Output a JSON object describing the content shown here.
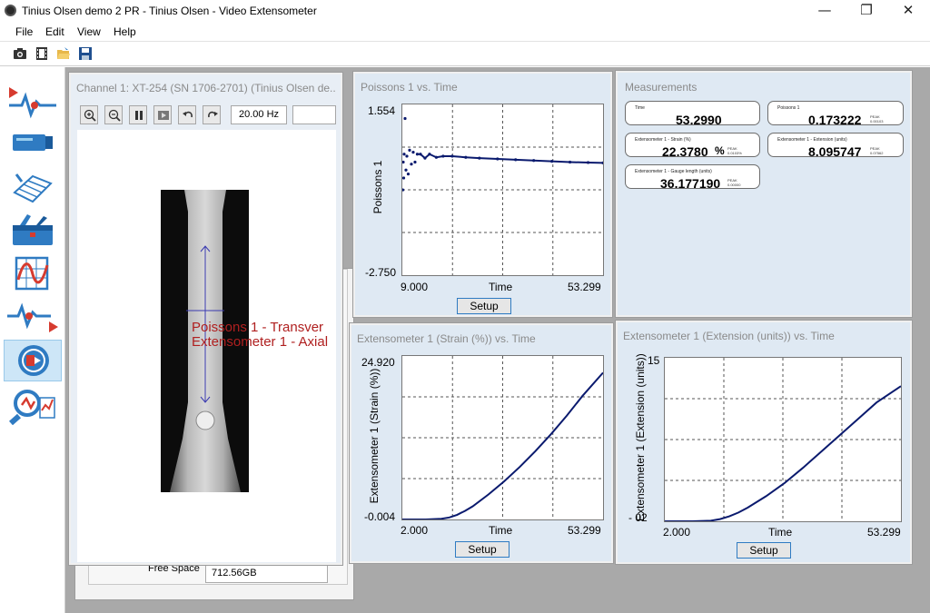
{
  "window": {
    "title": "Tinius Olsen demo 2 PR - Tinius Olsen - Video Extensometer",
    "minimize_glyph": "—",
    "maximize_glyph": "❐",
    "close_glyph": "✕"
  },
  "menu": [
    "File",
    "Edit",
    "View",
    "Help"
  ],
  "toolbar": {
    "icons": [
      "camera-icon",
      "film-icon",
      "open-folder-icon",
      "save-icon"
    ]
  },
  "left_rail": {
    "items": [
      {
        "icon": "signal-play-icon",
        "active": false
      },
      {
        "icon": "extensometer-device-icon",
        "active": false
      },
      {
        "icon": "calibration-grid-icon",
        "active": false
      },
      {
        "icon": "toolbox-icon",
        "active": false
      },
      {
        "icon": "wave-chart-icon",
        "active": false
      },
      {
        "icon": "signal-record-icon",
        "active": false
      },
      {
        "icon": "video-record-icon",
        "active": true
      },
      {
        "icon": "analysis-magnifier-icon",
        "active": false
      }
    ]
  },
  "video_panel": {
    "title": "Channel 1: XT-254 (SN 1706-2701) (Tinius Olsen de...",
    "frequency": "20.00 Hz",
    "buttons": [
      "zoom-in-icon",
      "zoom-out-icon",
      "pause-icon",
      "play-icon",
      "undo-icon",
      "redo-icon"
    ],
    "overlay_line1": "Poissons 1 - Transver",
    "overlay_line2": "Extensometer 1 - Axial"
  },
  "hidden_panel": {
    "free_space_label": "Free Space",
    "free_space_value": "712.56GB"
  },
  "colors": {
    "plot_line": "#0a1a6e",
    "overlay_text": "#b02020",
    "panel_title": "#8a8a8a",
    "active_rail": "#cde6f7",
    "setup_border": "#2f7bc2"
  },
  "charts": [
    {
      "title": "Poissons 1 vs. Time",
      "ylabel": "Poissons 1",
      "xlabel": "Time",
      "ymax_label": "1.554",
      "ymin_label": "-2.750",
      "xmin_label": "9.000",
      "xmax_label": "53.299",
      "setup": "Setup"
    },
    {
      "title": "Extensometer 1 (Strain (%)) vs. Time",
      "ylabel": "Extensometer 1 (Strain (%))",
      "xlabel": "Time",
      "ymax_label": "24.920",
      "ymin_label": "-0.004",
      "xmin_label": "2.000",
      "xmax_label": "53.299",
      "setup": "Setup"
    },
    {
      "title": "Extensometer 1 (Extension (units)) vs. Time",
      "ylabel": "Extensometer 1 (Extension (units))",
      "xlabel": "Time",
      "ymax_label": "15",
      "ymin_label": "- 02",
      "xmin_label": "2.000",
      "xmax_label": "53.299",
      "setup": "Setup"
    }
  ],
  "chart_data": [
    {
      "type": "scatter",
      "title": "Poissons 1 vs. Time",
      "xlabel": "Time",
      "ylabel": "Poissons 1",
      "xlim": [
        9.0,
        53.299
      ],
      "ylim": [
        -2.75,
        1.554
      ],
      "grid": true,
      "series": [
        {
          "x": [
            9.1,
            9.2,
            9.3,
            9.4,
            9.6,
            9.8,
            10.0,
            10.3,
            10.6,
            11.0,
            11.4,
            11.8,
            12.3,
            13.0,
            14.0,
            15.0,
            16.5,
            18.0,
            20.0,
            23.0,
            26.0,
            30.0,
            34.0,
            38.0,
            42.0,
            46.0,
            50.0,
            53.299
          ],
          "y": [
            -0.6,
            0.1,
            -0.3,
            0.3,
            1.2,
            -0.1,
            0.25,
            -0.2,
            0.4,
            0.05,
            0.35,
            0.1,
            0.3,
            0.3,
            0.2,
            0.3,
            0.22,
            0.25,
            0.25,
            0.22,
            0.2,
            0.18,
            0.16,
            0.14,
            0.12,
            0.1,
            0.09,
            0.08
          ]
        }
      ]
    },
    {
      "type": "line",
      "title": "Extensometer 1 (Strain (%)) vs. Time",
      "xlabel": "Time",
      "ylabel": "Extensometer 1 (Strain (%))",
      "xlim": [
        2.0,
        53.299
      ],
      "ylim": [
        -0.004,
        24.92
      ],
      "grid": true,
      "series": [
        {
          "x": [
            2.0,
            8.0,
            12.0,
            14.0,
            16.0,
            18.0,
            20.0,
            24.0,
            28.0,
            32.0,
            36.0,
            40.0,
            44.0,
            48.0,
            53.299
          ],
          "y": [
            0.0,
            0.0,
            0.1,
            0.3,
            0.7,
            1.3,
            2.0,
            3.8,
            5.8,
            8.0,
            10.4,
            13.0,
            15.8,
            18.8,
            22.378
          ]
        }
      ]
    },
    {
      "type": "line",
      "title": "Extensometer 1 (Extension (units)) vs. Time",
      "xlabel": "Time",
      "ylabel": "Extensometer 1 (Extension (units))",
      "xlim": [
        2.0,
        53.299
      ],
      "ylim": [
        0.0,
        15.0
      ],
      "grid": true,
      "series": [
        {
          "x": [
            2.0,
            8.0,
            12.0,
            14.0,
            16.0,
            18.0,
            20.0,
            24.0,
            28.0,
            32.0,
            36.0,
            40.0,
            44.0,
            48.0,
            53.299
          ],
          "y": [
            0.0,
            0.0,
            0.05,
            0.2,
            0.45,
            0.8,
            1.25,
            2.3,
            3.5,
            4.9,
            6.4,
            7.9,
            9.4,
            10.9,
            12.4
          ]
        }
      ]
    }
  ],
  "measurements": {
    "title": "Measurements",
    "items": [
      {
        "label": "Time",
        "value": "53.2990",
        "unit": "",
        "aux1": "",
        "aux2": ""
      },
      {
        "label": "Poissons 1",
        "value": "0.173222",
        "unit": "",
        "aux1": "PEAK",
        "aux2": "0.00103"
      },
      {
        "label": "Extensometer 1 - Strain (%)",
        "value": "22.3780",
        "unit": "%",
        "aux1": "PEAK",
        "aux2": "0.0103%"
      },
      {
        "label": "Extensometer 1 - Extension (units)",
        "value": "8.095747",
        "unit": "",
        "aux1": "PEAK",
        "aux2": "0.07562"
      },
      {
        "label": "Extensometer 1 - Gauge length (units)",
        "value": "36.177190",
        "unit": "",
        "aux1": "PEAK",
        "aux2": "0.00000"
      }
    ]
  }
}
